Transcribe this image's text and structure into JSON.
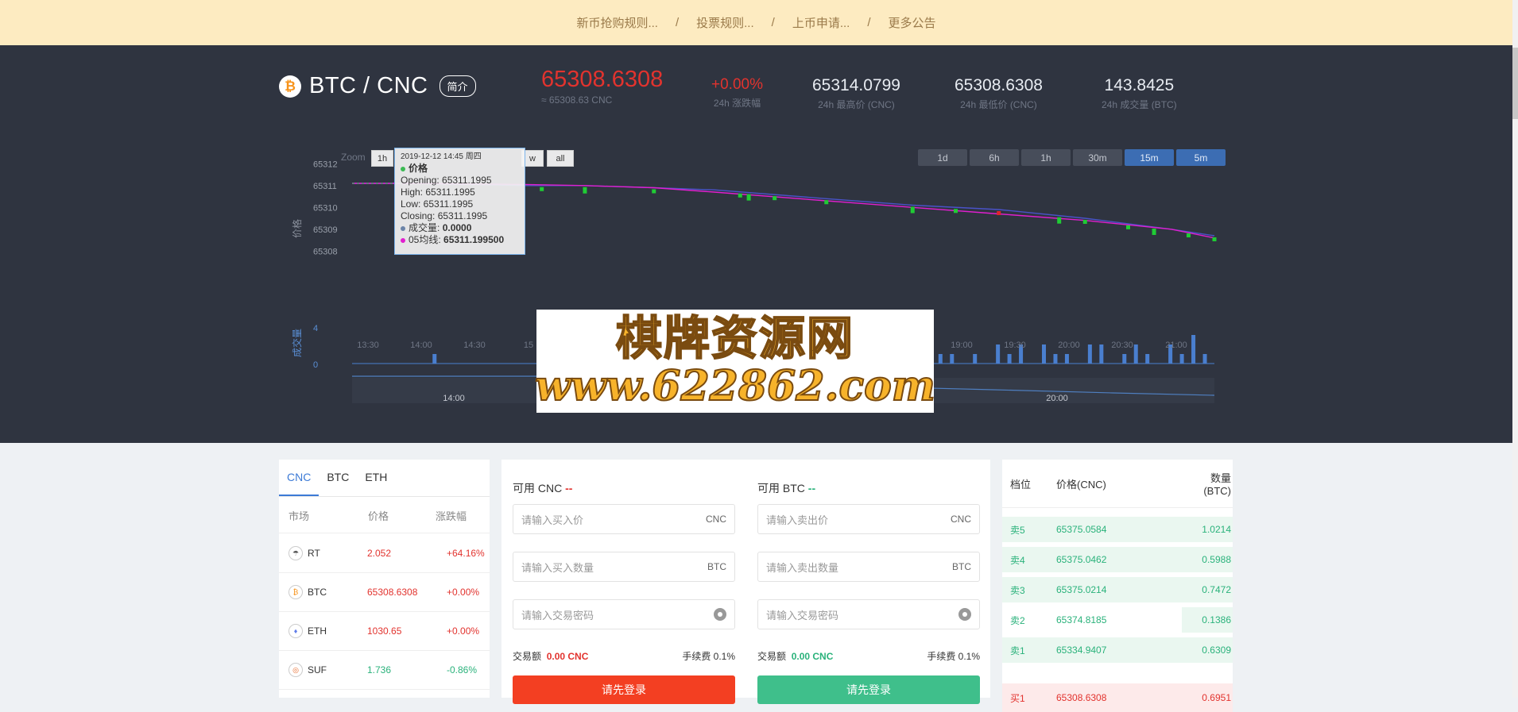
{
  "notice": {
    "items": [
      "新币抢购规则...",
      "投票规则...",
      "上币申请...",
      "更多公告"
    ],
    "separator": "/"
  },
  "header": {
    "coin_icon": "bitcoin-icon",
    "pair": "BTC / CNC",
    "intro_button": "简介",
    "last_price": "65308.6308",
    "last_price_cnc": "≈ 65308.63 CNC",
    "change": "+0.00%",
    "change_label": "24h 涨跌幅",
    "high": "65314.0799",
    "high_label": "24h 最高价 (CNC)",
    "low": "65308.6308",
    "low_label": "24h 最低价 (CNC)",
    "volume": "143.8425",
    "volume_label": "24h 成交量 (BTC)"
  },
  "chart_controls": {
    "zoom_label": "Zoom",
    "zoom_buttons": [
      "1h",
      "w",
      "all"
    ],
    "range_buttons": [
      "1d",
      "6h",
      "1h",
      "30m",
      "15m",
      "5m"
    ],
    "active_range": [
      "15m",
      "5m"
    ]
  },
  "chart_data": {
    "type": "line",
    "ylabel": "价格",
    "ylabel2": "成交量",
    "price_ticks": [
      "65312",
      "65311",
      "65310",
      "65309",
      "65308"
    ],
    "volume_ticks": [
      "4",
      "0"
    ],
    "time_ticks": [
      "13:30",
      "14:00",
      "14:30",
      "15",
      "19:00",
      "19:30",
      "20:00",
      "20:30",
      "21:00"
    ],
    "navigator_ticks": [
      "14:00",
      "20:00"
    ],
    "ylim": [
      65307.5,
      65312.3
    ],
    "series": [
      {
        "name": "价格",
        "x": [
          0,
          0.07,
          0.2,
          0.27,
          0.35,
          0.42,
          0.55,
          0.65,
          0.75,
          0.85,
          0.95,
          1.0
        ],
        "values": [
          65311.1,
          65311.1,
          65311.0,
          65311.0,
          65310.9,
          65310.8,
          65310.4,
          65310.1,
          65309.9,
          65309.5,
          65309.0,
          65308.7
        ]
      },
      {
        "name": "05均线",
        "x": [
          0,
          0.07,
          0.2,
          0.27,
          0.35,
          0.42,
          0.55,
          0.65,
          0.75,
          0.85,
          0.95,
          1.0
        ],
        "values": [
          65311.1,
          65311.1,
          65311.05,
          65311.0,
          65310.9,
          65310.7,
          65310.3,
          65310.0,
          65309.7,
          65309.4,
          65309.0,
          65308.6
        ]
      }
    ],
    "volume_bars": [
      0,
      0,
      0,
      0,
      0,
      0,
      0,
      1,
      0,
      0,
      0,
      0,
      0,
      0,
      0,
      0,
      0,
      0,
      0,
      0,
      0,
      0,
      0,
      0,
      0,
      0,
      0,
      0,
      0,
      0,
      0,
      0,
      0,
      0,
      0,
      0,
      0,
      0,
      0,
      0,
      0,
      0,
      0,
      0,
      0,
      0,
      1,
      1,
      1,
      0,
      1,
      1,
      1,
      0,
      1,
      0,
      2,
      1,
      2,
      0,
      2,
      1,
      1,
      0,
      2,
      2,
      0,
      1,
      2,
      1,
      0,
      2,
      1,
      3,
      1
    ]
  },
  "tooltip": {
    "date": "2019-12-12 14:45 周四",
    "series_name": "价格",
    "opening": "Opening: 65311.1995",
    "high": "High: 65311.1995",
    "low": "Low: 65311.1995",
    "closing": "Closing: 65311.1995",
    "volume_label": "成交量:",
    "volume_value": "0.0000",
    "ma_label": "05均线:",
    "ma_value": "65311.199500",
    "colors": {
      "price": "#3cba54",
      "volume": "#6b84a8",
      "ma": "#e11fcf"
    }
  },
  "watermark": {
    "line1": "棋牌资源网",
    "line2": "www.622862.com"
  },
  "market": {
    "tabs": [
      "CNC",
      "BTC",
      "ETH"
    ],
    "active_tab": "CNC",
    "headers": [
      "市场",
      "价格",
      "涨跌幅"
    ],
    "rows": [
      {
        "icon": "rt-icon",
        "name": "RT",
        "price": "2.052",
        "change": "+64.16%",
        "dir": "up"
      },
      {
        "icon": "bitcoin-icon",
        "name": "BTC",
        "price": "65308.6308",
        "change": "+0.00%",
        "dir": "up"
      },
      {
        "icon": "ethereum-icon",
        "name": "ETH",
        "price": "1030.65",
        "change": "+0.00%",
        "dir": "up"
      },
      {
        "icon": "suf-icon",
        "name": "SUF",
        "price": "1.736",
        "change": "-0.86%",
        "dir": "down"
      }
    ]
  },
  "trade": {
    "buy": {
      "avail_label": "可用 CNC",
      "avail_value": "--",
      "price_placeholder": "请输入买入价",
      "price_unit": "CNC",
      "qty_placeholder": "请输入买入数量",
      "qty_unit": "BTC",
      "pwd_placeholder": "请输入交易密码",
      "amount_label": "交易额",
      "amount_value": "0.00 CNC",
      "fee": "手续费 0.1%",
      "button": "请先登录",
      "color": "#f33f22"
    },
    "sell": {
      "avail_label": "可用 BTC",
      "avail_value": "--",
      "price_placeholder": "请输入卖出价",
      "price_unit": "CNC",
      "qty_placeholder": "请输入卖出数量",
      "qty_unit": "BTC",
      "pwd_placeholder": "请输入交易密码",
      "amount_label": "交易额",
      "amount_value": "0.00 CNC",
      "fee": "手续费 0.1%",
      "button": "请先登录",
      "color": "#3fbf8b"
    }
  },
  "orderbook": {
    "headers": [
      "档位",
      "价格(CNC)",
      "数量(BTC)"
    ],
    "asks": [
      {
        "level": "卖5",
        "price": "65375.0584",
        "qty": "1.0214",
        "depth": 1.0
      },
      {
        "level": "卖4",
        "price": "65375.0462",
        "qty": "0.5988",
        "depth": 1.0
      },
      {
        "level": "卖3",
        "price": "65375.0214",
        "qty": "0.7472",
        "depth": 1.0
      },
      {
        "level": "卖2",
        "price": "65374.8185",
        "qty": "0.1386",
        "depth": 0.22
      },
      {
        "level": "卖1",
        "price": "65334.9407",
        "qty": "0.6309",
        "depth": 1.0
      }
    ],
    "bids": [
      {
        "level": "买1",
        "price": "65308.6308",
        "qty": "0.6951"
      }
    ]
  }
}
